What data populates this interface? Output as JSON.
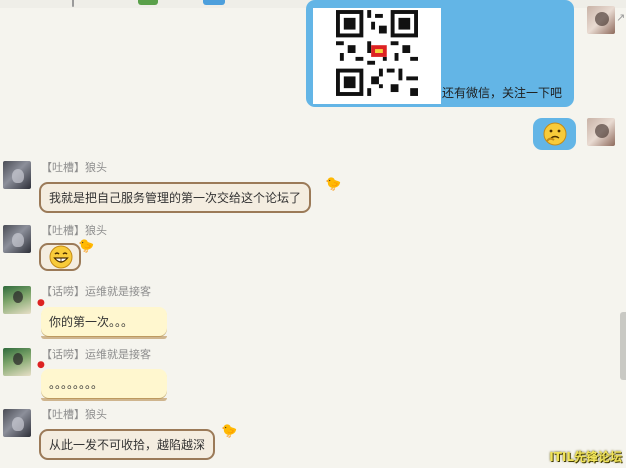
{
  "outgoing": {
    "qr_caption": "还有微信，关注一下吧",
    "emoji_icon": "thinking-face-icon"
  },
  "messages": [
    {
      "prefix": "【吐槽】",
      "name": "狼头",
      "text": "我就是把自己服务管理的第一次交给这个论坛了"
    },
    {
      "prefix": "【吐槽】",
      "name": "狼头",
      "emoji_icon": "grinning-face-icon"
    },
    {
      "prefix": "【话唠】",
      "name": "运维就是接客",
      "text": "你的第一次。。。"
    },
    {
      "prefix": "【话唠】",
      "name": "运维就是接客",
      "text": "。。。。。。。。"
    },
    {
      "prefix": "【吐槽】",
      "name": "狼头",
      "text": "从此一发不可收拾，越陷越深"
    }
  ],
  "watermark": "ITIL先锋论坛",
  "colors": {
    "background": "#f5f4ee",
    "outgoing_bubble": "#63b5e6",
    "tan_bubble": "#f4ede0",
    "yellow_bubble": "#fff7cf",
    "watermark": "#f0e35a"
  }
}
